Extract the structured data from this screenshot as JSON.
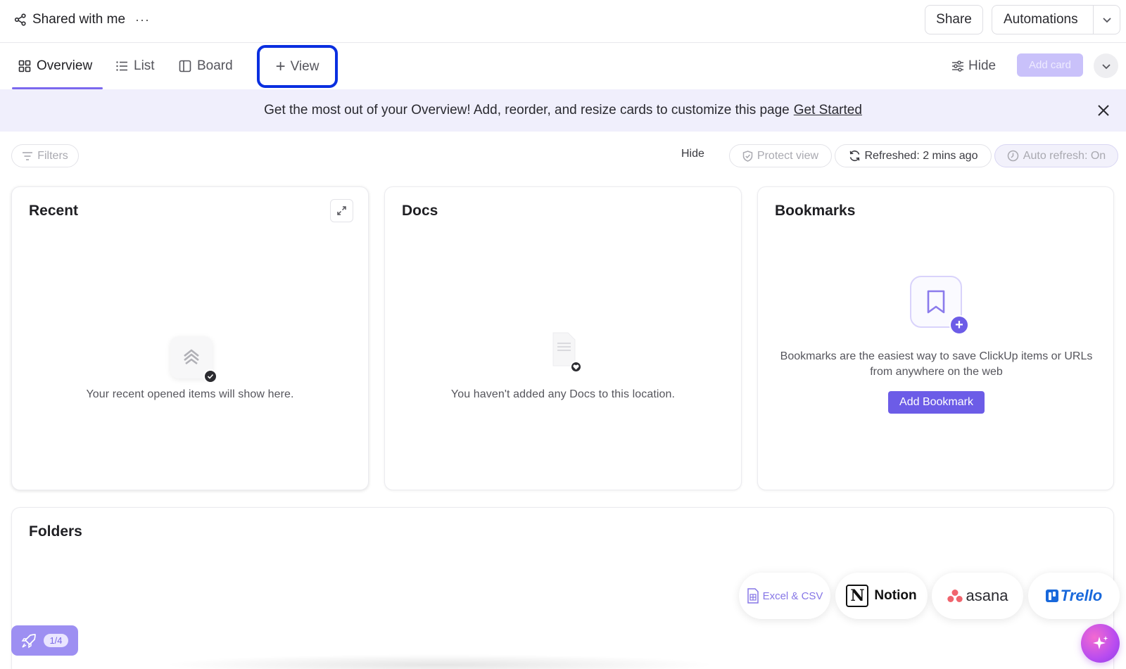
{
  "header": {
    "title": "Shared with me",
    "more": "···",
    "share_label": "Share",
    "automations_label": "Automations"
  },
  "tabs": [
    {
      "label": "Overview",
      "icon": "overview-grid-icon",
      "active": true
    },
    {
      "label": "List",
      "icon": "list-icon",
      "active": false
    },
    {
      "label": "Board",
      "icon": "board-icon",
      "active": false
    }
  ],
  "view_button": {
    "label": "View",
    "highlight_color": "#0a2fe0"
  },
  "toolbar": {
    "hide_label": "Hide",
    "add_card_label": "Add card"
  },
  "banner": {
    "text": "Get the most out of your Overview! Add, reorder, and resize cards to customize this page",
    "link": "Get Started"
  },
  "filter_row": {
    "filters_label": "Filters",
    "hide_label": "Hide",
    "protect_label": "Protect view",
    "refreshed_label": "Refreshed: 2 mins ago",
    "auto_refresh_label": "Auto refresh: On"
  },
  "cards": {
    "recent": {
      "title": "Recent",
      "empty_text": "Your recent opened items will show here."
    },
    "docs": {
      "title": "Docs",
      "empty_text": "You haven't added any Docs to this location."
    },
    "bookmarks": {
      "title": "Bookmarks",
      "text": "Bookmarks are the easiest way to save ClickUp items or URLs from anywhere on the web",
      "button": "Add Bookmark"
    },
    "folders": {
      "title": "Folders"
    }
  },
  "imports": {
    "excel": "Excel & CSV",
    "notion": "Notion",
    "asana": "asana",
    "trello": "Trello"
  },
  "onboarding": {
    "count": "1/4"
  },
  "colors": {
    "accent": "#7b68ee",
    "primary_button": "#6c5ce7",
    "banner_bg": "#f0effc"
  }
}
